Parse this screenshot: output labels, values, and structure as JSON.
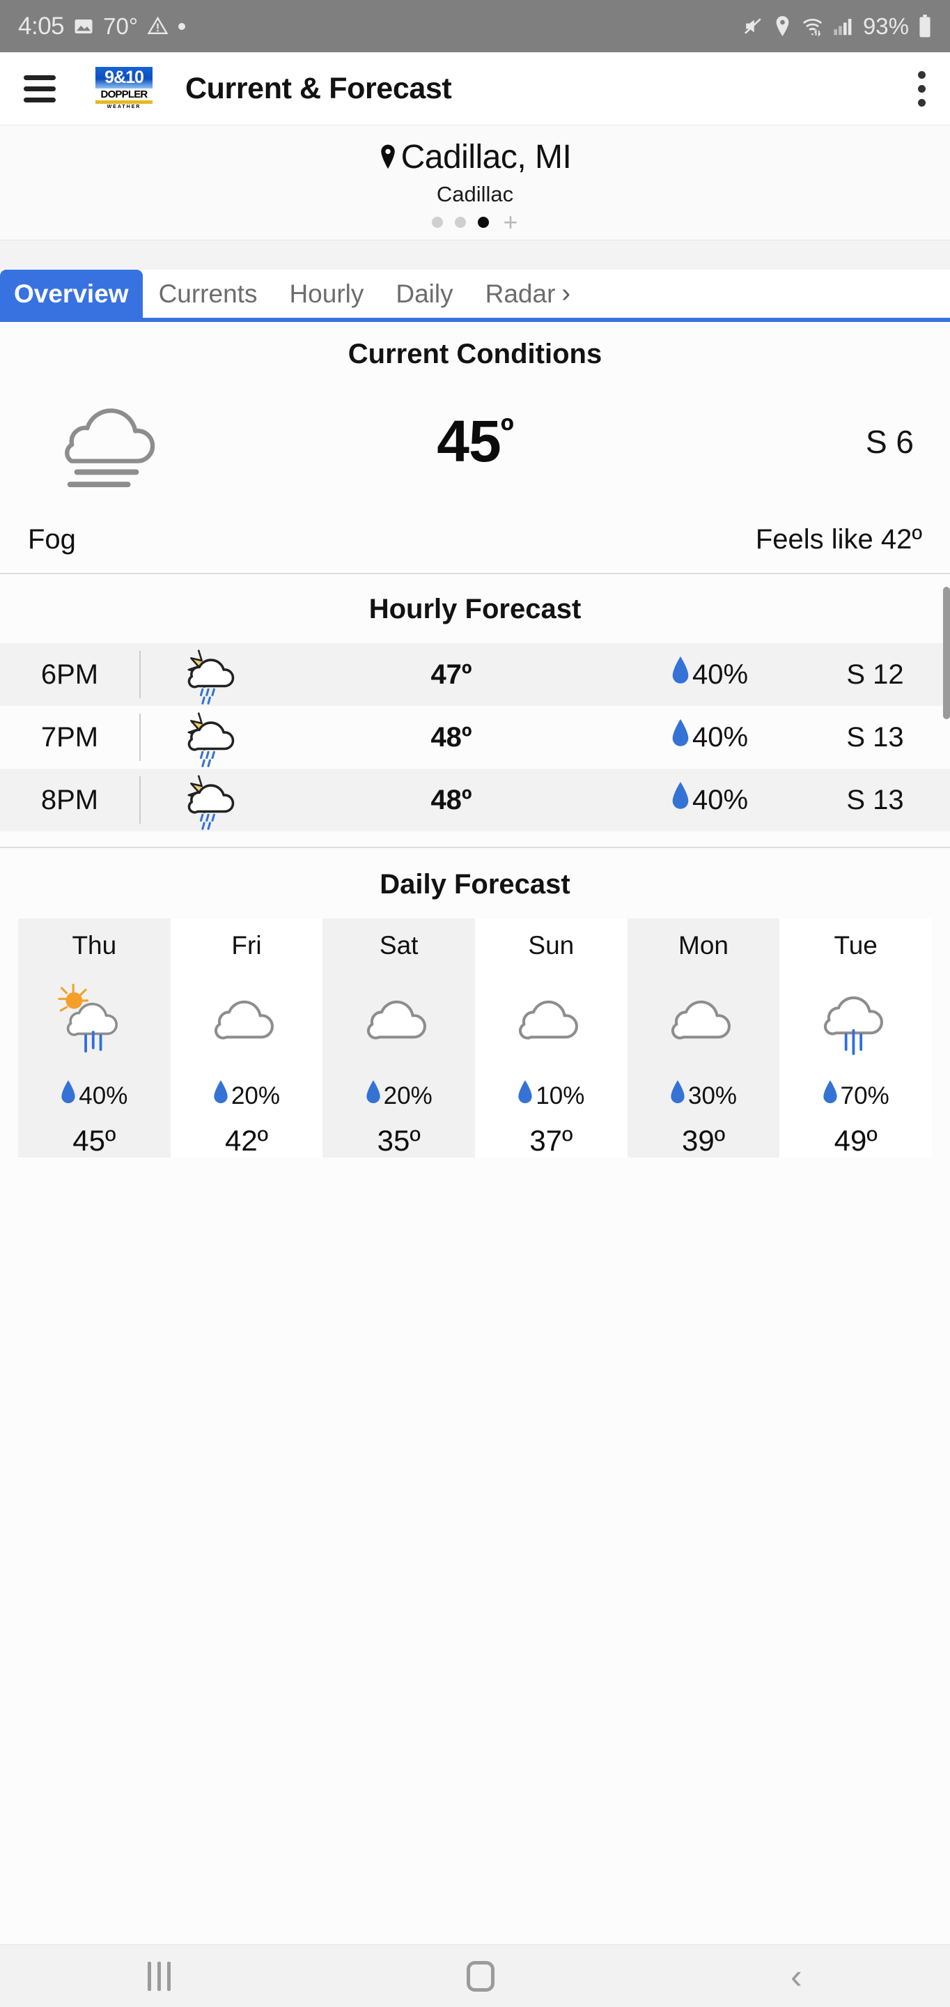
{
  "status_bar": {
    "clock": "4:05",
    "image_icon": "image-icon",
    "outdoor_temp": "70°",
    "warning_icon": "warning-triangle-icon",
    "dot_icon": "dot-indicator-icon",
    "mute_icon": "volume-mute-icon",
    "location_icon": "location-pin-icon",
    "wifi_icon": "wifi-icon",
    "signal_icon": "cellular-signal-icon",
    "battery_percent": "93%",
    "battery_icon": "battery-icon"
  },
  "app_bar": {
    "menu_icon": "hamburger-menu-icon",
    "logo": {
      "top": "9&10",
      "mid": "DOPPLER",
      "bottom": "WEATHER"
    },
    "title": "Current & Forecast",
    "overflow_icon": "kebab-menu-icon"
  },
  "location": {
    "pin_icon": "location-pin-icon",
    "name": "Cadillac, MI",
    "sub": "Cadillac",
    "pager": {
      "total": 3,
      "active_index": 2,
      "add_label": "+"
    }
  },
  "tabs": [
    {
      "label": "Overview",
      "active": true
    },
    {
      "label": "Currents",
      "active": false
    },
    {
      "label": "Hourly",
      "active": false
    },
    {
      "label": "Daily",
      "active": false
    },
    {
      "label": "Radar",
      "active": false,
      "chevron": "›"
    }
  ],
  "current_conditions": {
    "heading": "Current Conditions",
    "icon": "fog-icon",
    "temperature": "45",
    "degree": "º",
    "wind": "S 6",
    "condition": "Fog",
    "feels_like": "Feels like 42º"
  },
  "hourly": {
    "heading": "Hourly Forecast",
    "rows": [
      {
        "time": "6PM",
        "icon": "sun-cloud-rain-icon",
        "temp": "47º",
        "pop": "40%",
        "wind": "S 12",
        "shaded": true
      },
      {
        "time": "7PM",
        "icon": "sun-cloud-rain-icon",
        "temp": "48º",
        "pop": "40%",
        "wind": "S 13",
        "shaded": false
      },
      {
        "time": "8PM",
        "icon": "sun-cloud-rain-icon",
        "temp": "48º",
        "pop": "40%",
        "wind": "S 13",
        "shaded": true
      }
    ]
  },
  "daily": {
    "heading": "Daily Forecast",
    "days": [
      {
        "name": "Thu",
        "icon": "sun-cloud-rain-icon",
        "pop": "40%",
        "temp": "45º",
        "shaded": true
      },
      {
        "name": "Fri",
        "icon": "cloud-icon",
        "pop": "20%",
        "temp": "42º",
        "shaded": false
      },
      {
        "name": "Sat",
        "icon": "cloud-icon",
        "pop": "20%",
        "temp": "35º",
        "shaded": true
      },
      {
        "name": "Sun",
        "icon": "cloud-icon",
        "pop": "10%",
        "temp": "37º",
        "shaded": false
      },
      {
        "name": "Mon",
        "icon": "cloud-icon",
        "pop": "30%",
        "temp": "39º",
        "shaded": true
      },
      {
        "name": "Tue",
        "icon": "cloud-rain-icon",
        "pop": "70%",
        "temp": "49º",
        "shaded": false
      }
    ]
  },
  "nav_bar": {
    "recents_icon": "recents-icon",
    "home_icon": "home-icon",
    "back_icon": "back-icon"
  },
  "colors": {
    "accent_blue": "#3872e0",
    "droplet_blue": "#3572d6",
    "sun_yellow": "#f5cf6a",
    "sun_orange": "#f59f2a",
    "status_bar_gray": "#7f7f7f",
    "cloud_gray": "#8d8d8d"
  }
}
